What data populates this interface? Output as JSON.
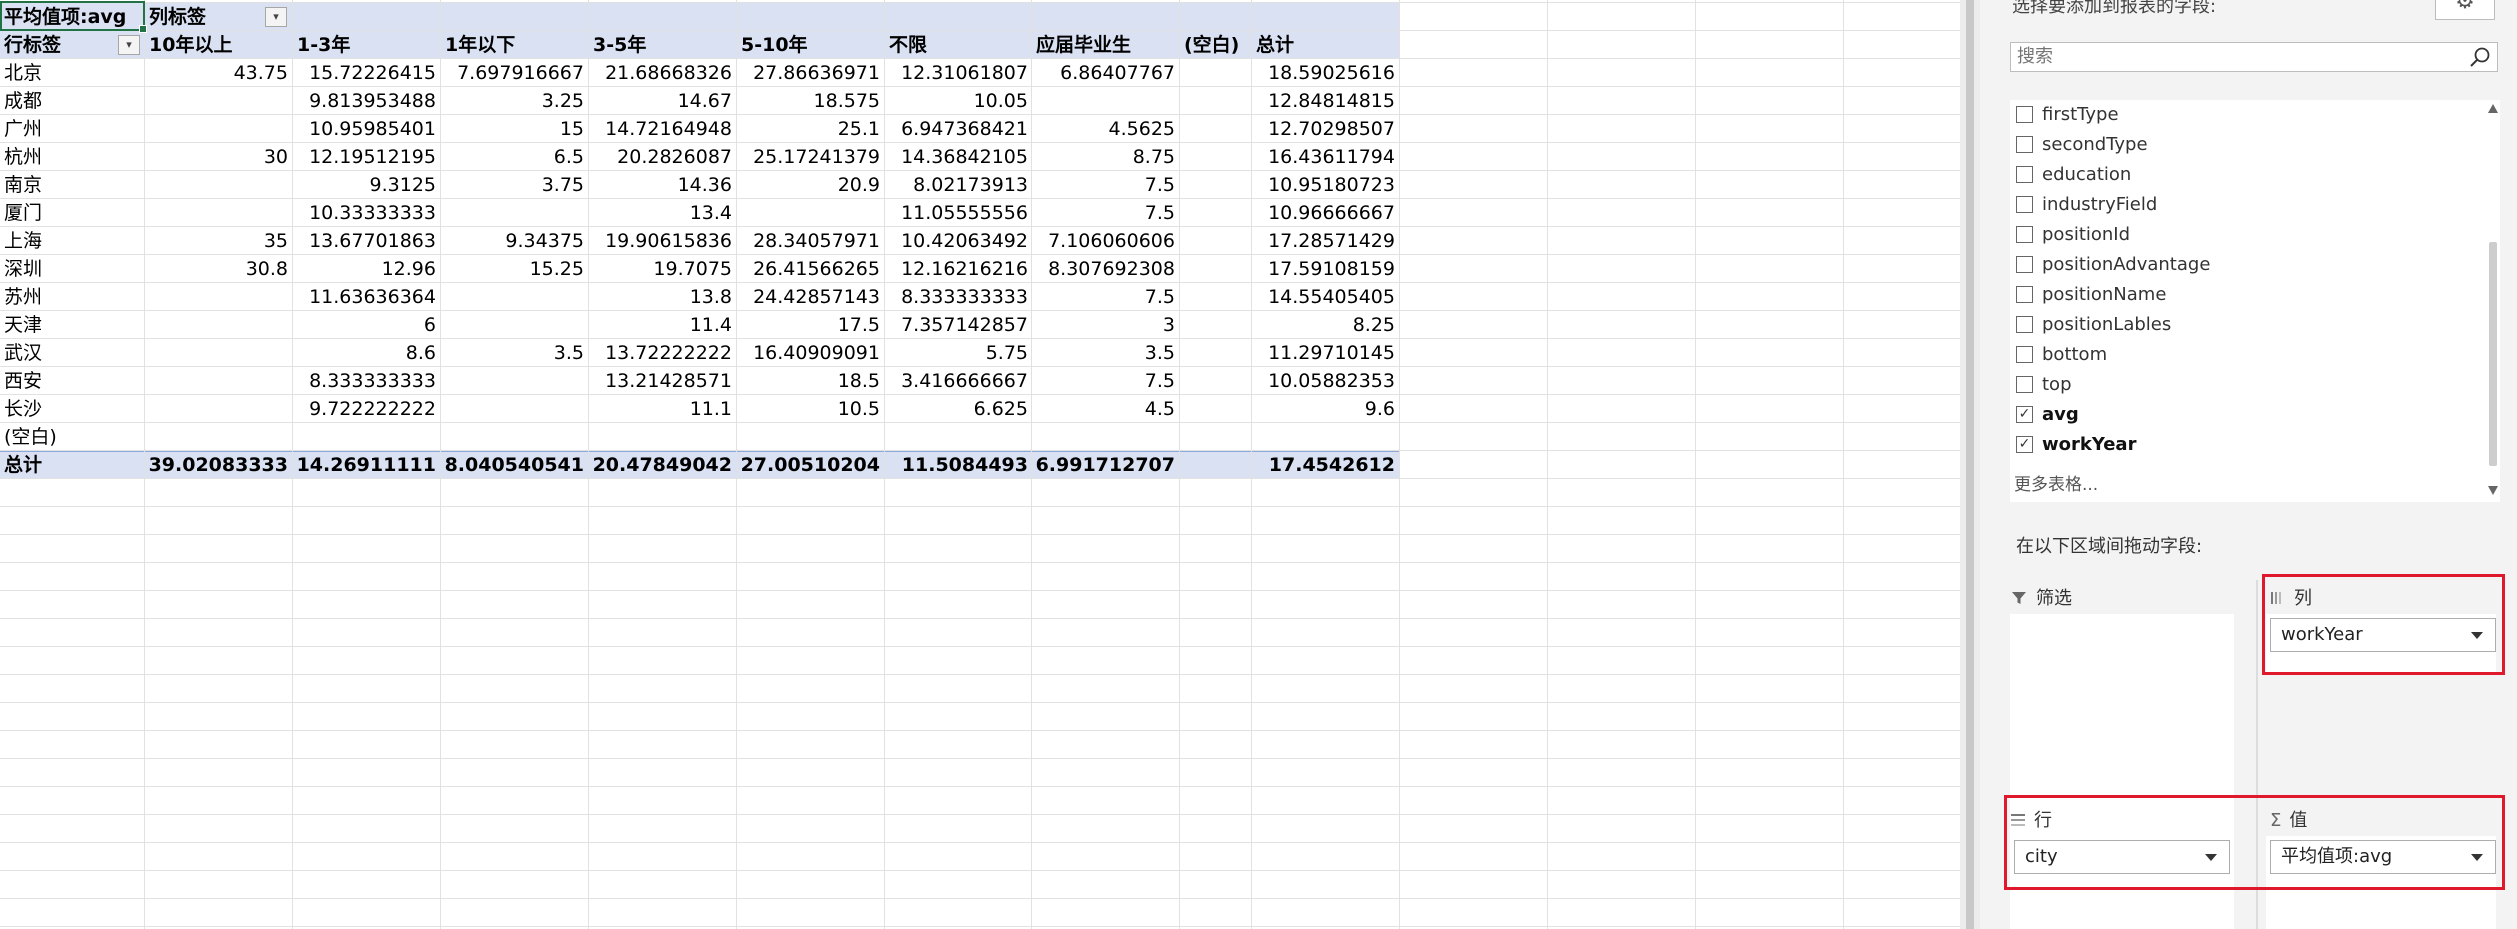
{
  "pivot": {
    "value_label": "平均值项:avg",
    "col_label": "列标签",
    "row_label": "行标签",
    "columns": [
      "10年以上",
      "1-3年",
      "1年以下",
      "3-5年",
      "5-10年",
      "不限",
      "应届毕业生",
      "(空白)",
      "总计"
    ],
    "rows": [
      {
        "city": "北京",
        "values": [
          "43.75",
          "15.72226415",
          "7.697916667",
          "21.68668326",
          "27.86636971",
          "12.31061807",
          "6.86407767",
          "",
          "18.59025616"
        ]
      },
      {
        "city": "成都",
        "values": [
          "",
          "9.813953488",
          "3.25",
          "14.67",
          "18.575",
          "10.05",
          "",
          "",
          "12.84814815"
        ]
      },
      {
        "city": "广州",
        "values": [
          "",
          "10.95985401",
          "15",
          "14.72164948",
          "25.1",
          "6.947368421",
          "4.5625",
          "",
          "12.70298507"
        ]
      },
      {
        "city": "杭州",
        "values": [
          "30",
          "12.19512195",
          "6.5",
          "20.2826087",
          "25.17241379",
          "14.36842105",
          "8.75",
          "",
          "16.43611794"
        ]
      },
      {
        "city": "南京",
        "values": [
          "",
          "9.3125",
          "3.75",
          "14.36",
          "20.9",
          "8.02173913",
          "7.5",
          "",
          "10.95180723"
        ]
      },
      {
        "city": "厦门",
        "values": [
          "",
          "10.33333333",
          "",
          "13.4",
          "",
          "11.05555556",
          "7.5",
          "",
          "10.96666667"
        ]
      },
      {
        "city": "上海",
        "values": [
          "35",
          "13.67701863",
          "9.34375",
          "19.90615836",
          "28.34057971",
          "10.42063492",
          "7.106060606",
          "",
          "17.28571429"
        ]
      },
      {
        "city": "深圳",
        "values": [
          "30.8",
          "12.96",
          "15.25",
          "19.7075",
          "26.41566265",
          "12.16216216",
          "8.307692308",
          "",
          "17.59108159"
        ]
      },
      {
        "city": "苏州",
        "values": [
          "",
          "11.63636364",
          "",
          "13.8",
          "24.42857143",
          "8.333333333",
          "7.5",
          "",
          "14.55405405"
        ]
      },
      {
        "city": "天津",
        "values": [
          "",
          "6",
          "",
          "11.4",
          "17.5",
          "7.357142857",
          "3",
          "",
          "8.25"
        ]
      },
      {
        "city": "武汉",
        "values": [
          "",
          "8.6",
          "3.5",
          "13.72222222",
          "16.40909091",
          "5.75",
          "3.5",
          "",
          "11.29710145"
        ]
      },
      {
        "city": "西安",
        "values": [
          "",
          "8.333333333",
          "",
          "13.21428571",
          "18.5",
          "3.416666667",
          "7.5",
          "",
          "10.05882353"
        ]
      },
      {
        "city": "长沙",
        "values": [
          "",
          "9.722222222",
          "",
          "11.1",
          "10.5",
          "6.625",
          "4.5",
          "",
          "9.6"
        ]
      },
      {
        "city": "(空白)",
        "values": [
          "",
          "",
          "",
          "",
          "",
          "",
          "",
          "",
          ""
        ]
      }
    ],
    "total": {
      "label": "总计",
      "values": [
        "39.02083333",
        "14.26911111",
        "8.040540541",
        "20.47849042",
        "27.00510204",
        "11.5084493",
        "6.991712707",
        "",
        "17.4542612"
      ]
    }
  },
  "fields_pane": {
    "header": "选择要添加到报表的字段:",
    "search_placeholder": "搜索",
    "fields": [
      {
        "name": "firstType",
        "checked": false
      },
      {
        "name": "secondType",
        "checked": false
      },
      {
        "name": "education",
        "checked": false
      },
      {
        "name": "industryField",
        "checked": false
      },
      {
        "name": "positionId",
        "checked": false
      },
      {
        "name": "positionAdvantage",
        "checked": false
      },
      {
        "name": "positionName",
        "checked": false
      },
      {
        "name": "positionLables",
        "checked": false
      },
      {
        "name": "bottom",
        "checked": false
      },
      {
        "name": "top",
        "checked": false
      },
      {
        "name": "avg",
        "checked": true
      },
      {
        "name": "workYear",
        "checked": true
      }
    ],
    "more_tables": "更多表格...",
    "drag_hint": "在以下区域间拖动字段:",
    "areas": {
      "filter": {
        "title": "筛选"
      },
      "columns": {
        "title": "列",
        "item": "workYear"
      },
      "rows": {
        "title": "行",
        "item": "city"
      },
      "values": {
        "title": "值",
        "item": "平均值项:avg"
      }
    },
    "highlight_color": "#e0182c"
  }
}
